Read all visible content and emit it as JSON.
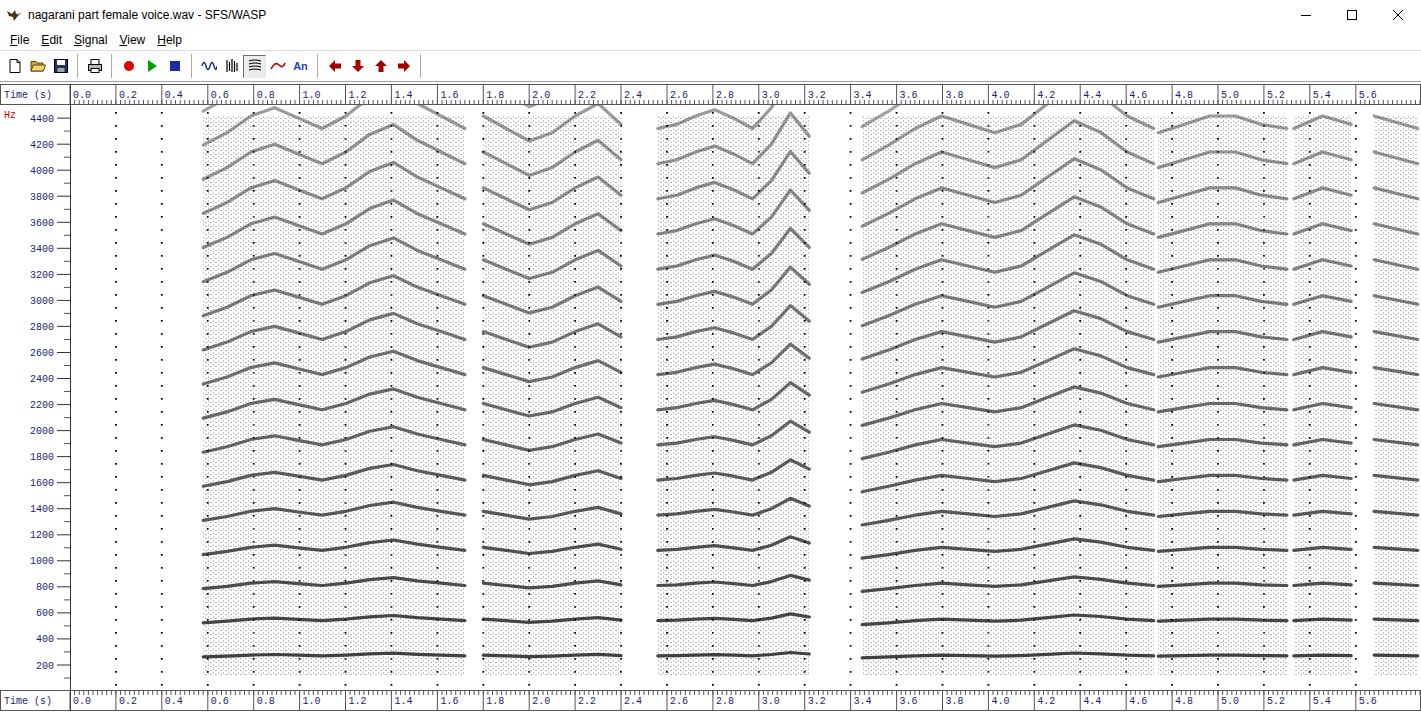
{
  "window": {
    "title": "nagarani part female voice.wav - SFS/WASP"
  },
  "menu": [
    "File",
    "Edit",
    "Signal",
    "View",
    "Help"
  ],
  "toolbar": [
    [
      {
        "kind": "new",
        "selected": false
      },
      {
        "kind": "open",
        "selected": false
      },
      {
        "kind": "save",
        "selected": false
      }
    ],
    [
      {
        "kind": "print",
        "selected": false
      }
    ],
    [
      {
        "kind": "record",
        "selected": false
      },
      {
        "kind": "play",
        "selected": false
      },
      {
        "kind": "stop",
        "selected": false
      }
    ],
    [
      {
        "kind": "waveform",
        "selected": false
      },
      {
        "kind": "spectrum",
        "selected": false
      },
      {
        "kind": "spectrogram",
        "selected": true
      },
      {
        "kind": "pitch",
        "selected": false
      },
      {
        "kind": "annotation",
        "label": "An",
        "selected": false
      }
    ],
    [
      {
        "kind": "left",
        "selected": false
      },
      {
        "kind": "down",
        "selected": false
      },
      {
        "kind": "up",
        "selected": false
      },
      {
        "kind": "right",
        "selected": false
      }
    ]
  ],
  "chart": {
    "time_axis_label": "Time (s)",
    "frequency_axis_label": "Hz",
    "time_ticks": [
      "0.0",
      "0.2",
      "0.4",
      "0.6",
      "0.8",
      "1.0",
      "1.2",
      "1.4",
      "1.6",
      "1.8",
      "2.0",
      "2.2",
      "2.4",
      "2.6",
      "2.8",
      "3.0",
      "3.2",
      "3.4",
      "3.6",
      "3.8",
      "4.0",
      "4.2",
      "4.4",
      "4.6",
      "4.8",
      "5.0",
      "5.2",
      "5.4",
      "5.6"
    ],
    "frequency_ticks": [
      "4400",
      "4200",
      "4000",
      "3800",
      "3600",
      "3400",
      "3200",
      "3000",
      "2800",
      "2600",
      "2400",
      "2200",
      "2000",
      "1800",
      "1600",
      "1400",
      "1200",
      "1000",
      "800",
      "600",
      "400",
      "200"
    ],
    "segments": [
      {
        "start": 0.58,
        "end": 1.72,
        "f0": [
          262,
          268,
          276,
          280,
          275,
          270,
          276,
          285,
          290,
          282,
          276,
          270
        ]
      },
      {
        "start": 1.8,
        "end": 2.4,
        "f0": [
          276,
          270,
          264,
          268,
          276,
          282,
          272
        ]
      },
      {
        "start": 2.56,
        "end": 3.22,
        "f0": [
          270,
          272,
          276,
          279,
          275,
          270,
          280,
          296,
          284
        ]
      },
      {
        "start": 3.45,
        "end": 4.72,
        "f0": [
          255,
          262,
          270,
          276,
          272,
          268,
          272,
          282,
          292,
          286,
          276,
          270
        ]
      },
      {
        "start": 4.74,
        "end": 5.3,
        "f0": [
          268,
          272,
          276,
          276,
          272,
          270
        ]
      },
      {
        "start": 5.33,
        "end": 5.58,
        "f0": [
          270,
          276,
          272
        ]
      },
      {
        "start": 5.68,
        "end": 5.87,
        "f0": [
          276,
          270
        ]
      }
    ]
  }
}
